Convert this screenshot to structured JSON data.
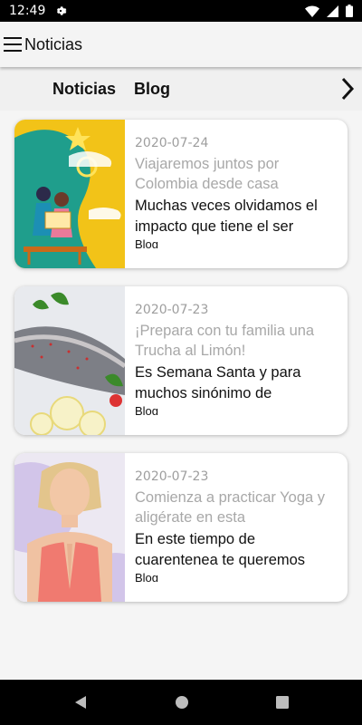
{
  "status": {
    "time": "12:49",
    "icons": [
      "gear-icon",
      "wifi-icon",
      "signal-icon",
      "battery-icon"
    ]
  },
  "app_bar": {
    "title": "Noticias",
    "icon": "menu-icon"
  },
  "tabs": [
    {
      "label": "Noticias"
    },
    {
      "label": "Blog"
    }
  ],
  "articles": [
    {
      "date": "2020-07-24",
      "title": "Viajaremos juntos por Colombia desde casa",
      "summary": "Muchas veces olvidamos el impacto que tiene el ser",
      "category": "Blog",
      "image": "illustration-reading-map"
    },
    {
      "date": "2020-07-23",
      "title": "¡Prepara con tu familia una Trucha al Limón!",
      "summary": "Es Semana Santa y para muchos sinónimo de",
      "category": "Blog",
      "image": "photo-trout-lemon"
    },
    {
      "date": "2020-07-23",
      "title": "Comienza a practicar Yoga y aligérate en esta",
      "summary": "En este tiempo de cuarentenea te queremos",
      "category": "Blog",
      "image": "photo-yoga-woman"
    }
  ],
  "nav": {
    "icons": [
      "back-icon",
      "home-icon",
      "recents-icon"
    ]
  },
  "colors": {
    "accent": "#f2c318",
    "muted": "#a8a8a8",
    "app_bar": "#f4f4f4"
  }
}
